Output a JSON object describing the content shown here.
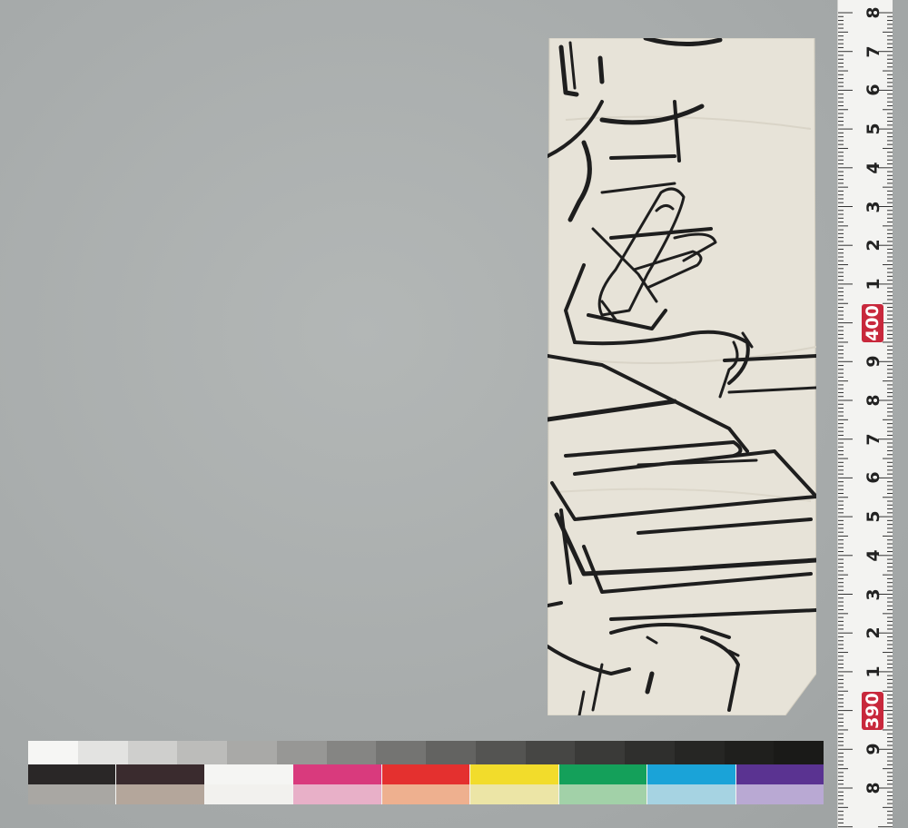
{
  "scene": {
    "paper_color": "#e7e3d8",
    "ink_color": "#1e1e1e",
    "background_color": "#a9adad"
  },
  "ruler": {
    "labels": [
      "8",
      "7",
      "6",
      "5",
      "4",
      "3",
      "2",
      "1",
      "400",
      "9",
      "8",
      "7",
      "6",
      "5",
      "4",
      "3",
      "2",
      "1",
      "390",
      "9",
      "8"
    ],
    "badges": [
      "400",
      "390"
    ],
    "badge_color": "#c8283c"
  },
  "color_target": {
    "grey_steps": [
      "#f6f6f4",
      "#e3e3e1",
      "#cfcfcd",
      "#bcbcba",
      "#a9a9a7",
      "#979795",
      "#858583",
      "#747472",
      "#636361",
      "#545452",
      "#464644",
      "#3a3a38",
      "#2f2f2d",
      "#262624",
      "#1f1f1d",
      "#1a1a18"
    ],
    "main_patches": [
      "#2a2727",
      "#3a2b2e",
      "#f5f5f3",
      "#d93a7d",
      "#e4302f",
      "#f2dc2b",
      "#14a05a",
      "#1aa3d8",
      "#5a3391"
    ],
    "light_patches": [
      "#a9a7a3",
      "#b4a69b",
      "#f2f1ee",
      "#e8b0c8",
      "#eeb08f",
      "#ece5a6",
      "#a2d1a8",
      "#a6d3e2",
      "#b9a9d3"
    ]
  }
}
